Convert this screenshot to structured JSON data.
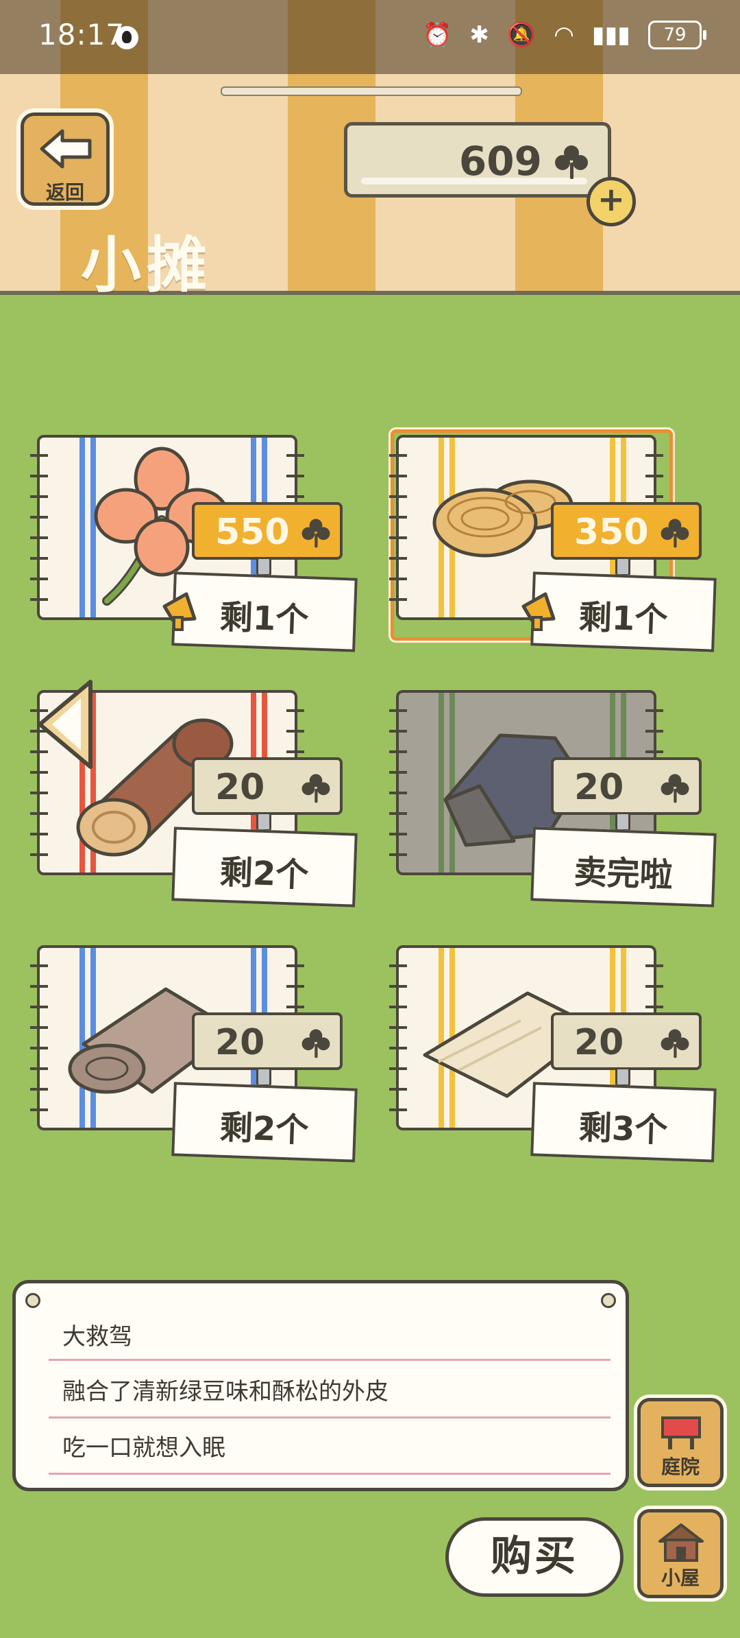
{
  "status_bar": {
    "time": "18:17",
    "battery": "79",
    "icons": [
      "alarm-icon",
      "bluetooth-icon",
      "mute-icon",
      "wifi-icon",
      "4g-signal-icon"
    ]
  },
  "header": {
    "back_label": "返回",
    "title": "小摊",
    "clover_count": "609"
  },
  "items": [
    {
      "name": "clover",
      "price": "550",
      "price_style": "gold",
      "stock": "剩1个",
      "promo": true,
      "selected": false
    },
    {
      "name": "pastry",
      "price": "350",
      "price_style": "gold",
      "stock": "剩1个",
      "promo": true,
      "selected": true
    },
    {
      "name": "log",
      "price": "20",
      "price_style": "plain",
      "stock": "剩2个",
      "promo": false,
      "selected": false
    },
    {
      "name": "stone",
      "price": "20",
      "price_style": "plain",
      "stock": "卖完啦",
      "promo": false,
      "selected": false
    },
    {
      "name": "cloth-roll",
      "price": "20",
      "price_style": "plain",
      "stock": "剩2个",
      "promo": false,
      "selected": false
    },
    {
      "name": "paper",
      "price": "20",
      "price_style": "plain",
      "stock": "剩3个",
      "promo": false,
      "selected": false
    }
  ],
  "description": {
    "title": "大救驾",
    "line1": "融合了清新绿豆味和酥松的外皮",
    "line2": "吃一口就想入眠"
  },
  "buttons": {
    "buy": "购买",
    "yard": "庭院",
    "house": "小屋"
  },
  "colors": {
    "grass": "#9cc25f",
    "gold_tag": "#f2b02f",
    "selection": "#ee8d32"
  }
}
